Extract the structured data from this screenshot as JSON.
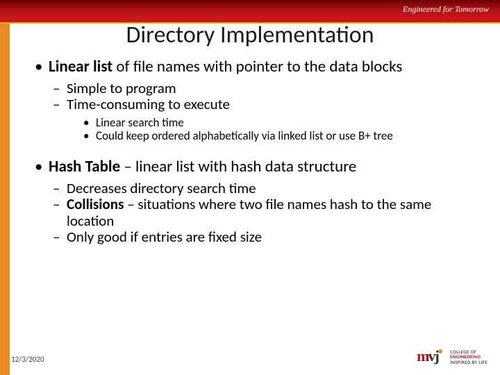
{
  "brand": {
    "tagline": "Engineered for Tomorrow",
    "logo_line1": "COLLEGE OF",
    "logo_line2": "ENGINEERING",
    "logo_line3": "INSPIRED BY LIFE"
  },
  "slide": {
    "title": "Directory Implementation",
    "bullets": {
      "linear_list": {
        "lead_bold": "Linear list",
        "trail": " of file names with pointer to the data blocks",
        "sub1": "Simple to program",
        "sub2": "Time-consuming to execute",
        "subsub1": "Linear search time",
        "subsub2": "Could keep ordered alphabetically via linked list or use B+ tree"
      },
      "hash_table": {
        "lead_bold": "Hash Table",
        "trail": " – linear list with hash data structure",
        "sub1": "Decreases directory search time",
        "sub2_bold": "Collisions",
        "sub2_trail": " – situations where two file names hash to the same location",
        "sub3": "Only good if entries are fixed size"
      }
    }
  },
  "footer": {
    "date": "12/3/2020"
  }
}
